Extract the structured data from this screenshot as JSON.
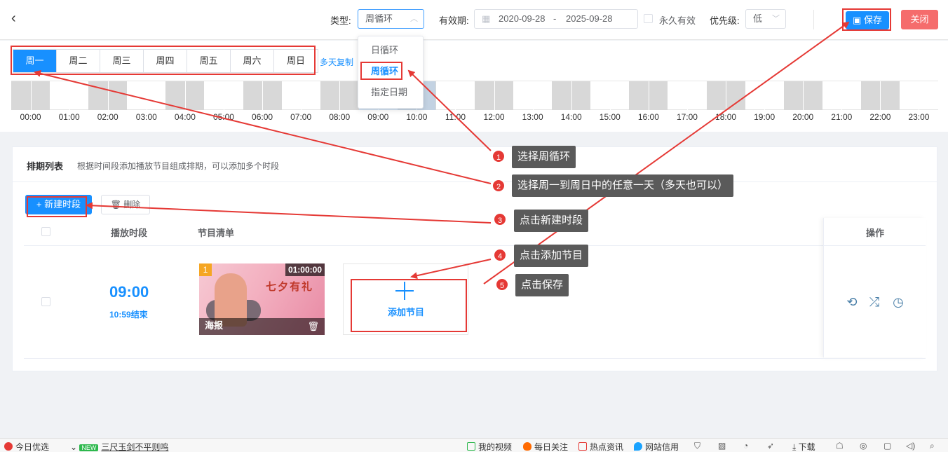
{
  "header": {
    "back_icon": "chevron-left-icon",
    "type_label": "类型:",
    "type_value": "周循环",
    "validity_label": "有效期:",
    "date_start": "2020-09-28",
    "date_sep": "-",
    "date_end": "2025-09-28",
    "permanent_label": "永久有效",
    "priority_label": "优先级:",
    "priority_value": "低",
    "save_label": "保存",
    "close_label": "关闭"
  },
  "type_dropdown": {
    "options": [
      "日循环",
      "周循环",
      "指定日期"
    ],
    "selected": "周循环"
  },
  "week": {
    "days": [
      "周一",
      "周二",
      "周三",
      "周四",
      "周五",
      "周六",
      "周日"
    ],
    "active": "周一",
    "multi_copy": "多天复制"
  },
  "timeline": {
    "hours": [
      "00:00",
      "01:00",
      "02:00",
      "03:00",
      "04:00",
      "05:00",
      "06:00",
      "07:00",
      "08:00",
      "09:00",
      "10:00",
      "11:00",
      "12:00",
      "13:00",
      "14:00",
      "15:00",
      "16:00",
      "17:00",
      "18:00",
      "19:00",
      "20:00",
      "21:00",
      "22:00",
      "23:00"
    ],
    "highlight_start": "09:00",
    "highlight_end": "10:59"
  },
  "schedule": {
    "title": "排期列表",
    "subtitle": "根据时间段添加播放节目组成排期，可以添加多个时段",
    "new_button": "+ 新建时段",
    "delete_button": "删除",
    "columns": {
      "time": "播放时段",
      "program": "节目清单",
      "ops": "操作"
    },
    "rows": [
      {
        "start": "09:00",
        "end": "10:59结束",
        "program": {
          "index": "1",
          "duration": "01:00:00",
          "kind": "海报",
          "title": "七夕有礼"
        },
        "add_label": "添加节目"
      }
    ]
  },
  "annotations": [
    {
      "num": "1",
      "text": "选择周循环"
    },
    {
      "num": "2",
      "text": "选择周一到周日中的任意一天（多天也可以）"
    },
    {
      "num": "3",
      "text": "点击新建时段"
    },
    {
      "num": "4",
      "text": "点击添加节目"
    },
    {
      "num": "5",
      "text": "点击保存"
    }
  ],
  "statusbar": {
    "left1": "今日优选",
    "news_tag": "NEW",
    "news_text": "三尺玉剑不平则鸣",
    "right": [
      "我的视频",
      "每日关注",
      "热点资讯",
      "网站信用",
      "下载"
    ]
  },
  "colors": {
    "primary": "#1890ff",
    "danger": "#f56c6c",
    "annotation_red": "#e53935"
  }
}
